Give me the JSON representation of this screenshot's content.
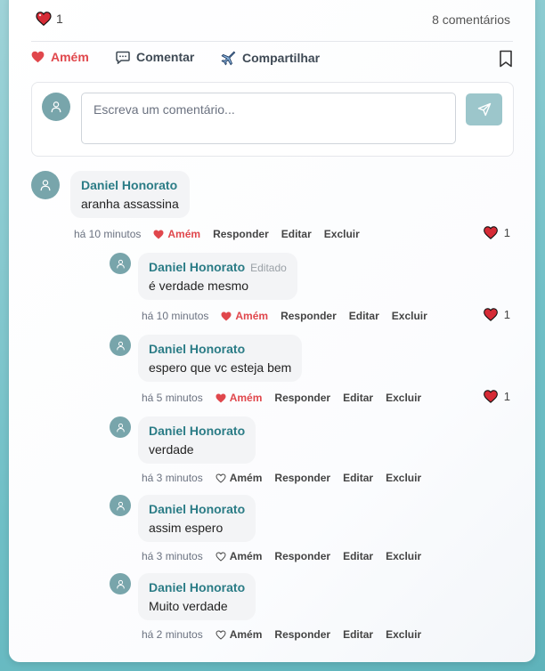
{
  "post": {
    "reaction_count": "1",
    "comments_count": "8 comentários",
    "actions": {
      "amem": "Amém",
      "comment": "Comentar",
      "share": "Compartilhar"
    }
  },
  "composer": {
    "placeholder": "Escreva um comentário..."
  },
  "comments": [
    {
      "author": "Daniel Honorato",
      "edited": "",
      "text": "aranha assassina",
      "time": "há 10 minutos",
      "amem": "Amém",
      "reply": "Responder",
      "edit": "Editar",
      "delete": "Excluir",
      "likes": "1",
      "liked": true
    },
    {
      "author": "Daniel Honorato",
      "edited": "Editado",
      "text": "é verdade mesmo",
      "time": "há 10 minutos",
      "amem": "Amém",
      "reply": "Responder",
      "edit": "Editar",
      "delete": "Excluir",
      "likes": "1",
      "liked": true
    },
    {
      "author": "Daniel Honorato",
      "edited": "",
      "text": "espero que vc esteja bem",
      "time": "há 5 minutos",
      "amem": "Amém",
      "reply": "Responder",
      "edit": "Editar",
      "delete": "Excluir",
      "likes": "1",
      "liked": true
    },
    {
      "author": "Daniel Honorato",
      "edited": "",
      "text": "verdade",
      "time": "há 3 minutos",
      "amem": "Amém",
      "reply": "Responder",
      "edit": "Editar",
      "delete": "Excluir",
      "likes": "",
      "liked": false
    },
    {
      "author": "Daniel Honorato",
      "edited": "",
      "text": "assim espero",
      "time": "há 3 minutos",
      "amem": "Amém",
      "reply": "Responder",
      "edit": "Editar",
      "delete": "Excluir",
      "likes": "",
      "liked": false
    },
    {
      "author": "Daniel Honorato",
      "edited": "",
      "text": "Muito verdade",
      "time": "há 2 minutos",
      "amem": "Amém",
      "reply": "Responder",
      "edit": "Editar",
      "delete": "Excluir",
      "likes": "",
      "liked": false
    }
  ],
  "colors": {
    "accent": "#2b7c86",
    "amem_red": "#e0474c",
    "avatar": "#78a5ab",
    "send_button": "#9cc6cb"
  }
}
